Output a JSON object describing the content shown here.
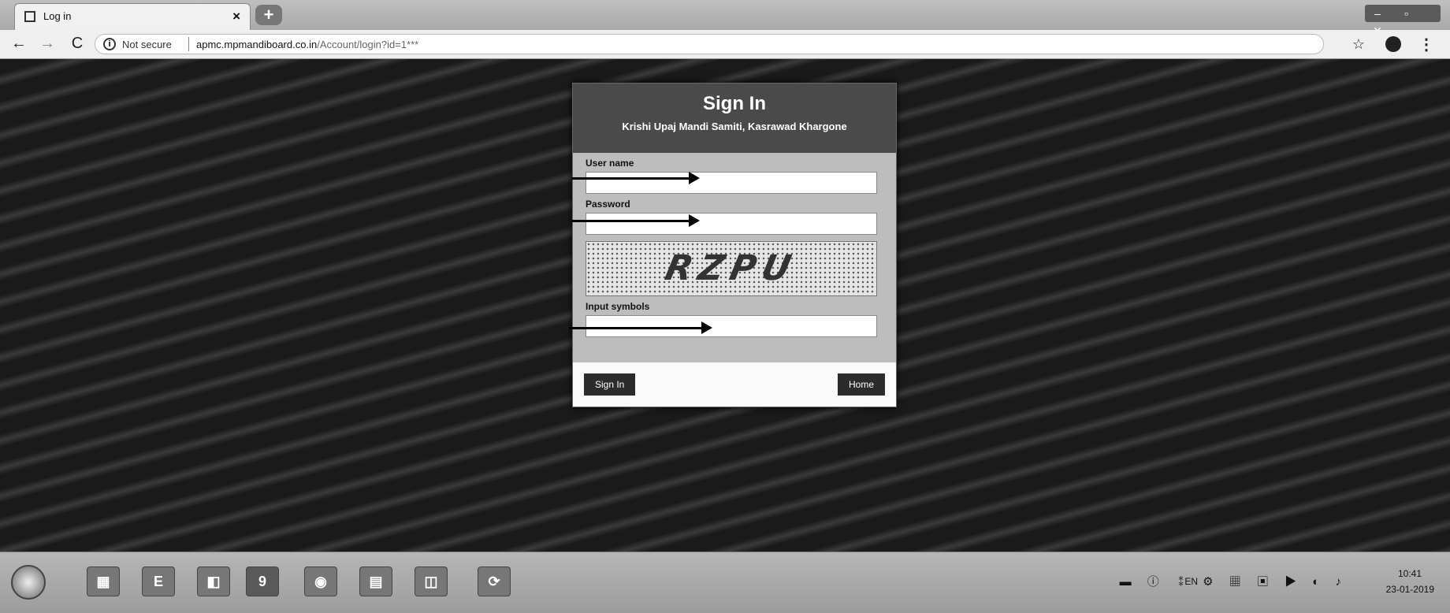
{
  "browser": {
    "tab_title": "Log in",
    "tab_close": "×",
    "new_tab": "+",
    "window_controls": [
      "–",
      "▫",
      "✕"
    ],
    "nav": {
      "back": "←",
      "forward": "→",
      "reload": "C"
    },
    "address": {
      "security_label": "Not secure",
      "url_domain": "apmc.mpmandiboard.co.in",
      "url_path": "/Account/login?id=1***"
    },
    "icons": {
      "bookmark": "star-icon",
      "profile": "profile-icon",
      "menu": "menu-icon"
    }
  },
  "signin": {
    "title": "Sign In",
    "subtitle": "Krishi Upaj Mandi Samiti, Kasrawad Khargone",
    "username_label": "User name",
    "username_value": "",
    "password_label": "Password",
    "password_value": "",
    "captcha_text": "RZPU",
    "symbols_label": "Input symbols",
    "symbols_value": "",
    "signin_button": "Sign In",
    "home_button": "Home"
  },
  "taskbar": {
    "start_icon": "windows-start-icon",
    "apps": [
      "E",
      "◧",
      "9",
      "◉",
      "▤",
      "◫",
      "⟳"
    ],
    "language": "EN",
    "tray_icons": "▬ ⓘ ⁑ ⚙ ▦ ▣ ▶ ◐ ♪",
    "time": "10:41",
    "date": "23-01-2019"
  },
  "colors": {
    "card_header": "#4a4a4a",
    "button": "#2b2b2b"
  }
}
